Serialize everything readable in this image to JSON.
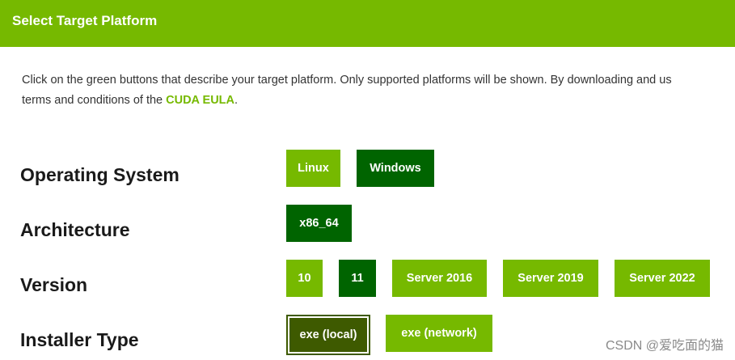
{
  "header": {
    "title": "Select Target Platform",
    "accent_color": "#76b900"
  },
  "intro": {
    "line1": "Click on the green buttons that describe your target platform. Only supported platforms will be shown. By downloading and us",
    "line2_prefix": "terms and conditions of the ",
    "eula_link": "CUDA EULA",
    "line2_suffix": "."
  },
  "rows": {
    "os": {
      "label": "Operating System",
      "options": [
        "Linux",
        "Windows"
      ],
      "selected": "Windows"
    },
    "arch": {
      "label": "Architecture",
      "options": [
        "x86_64"
      ],
      "selected": "x86_64"
    },
    "version": {
      "label": "Version",
      "options": [
        "10",
        "11",
        "Server 2016",
        "Server 2019",
        "Server 2022"
      ],
      "selected": "11"
    },
    "installer": {
      "label": "Installer Type",
      "options": [
        "exe (local)",
        "exe (network)"
      ],
      "selected": "exe (local)"
    }
  },
  "colors": {
    "option": "#76b900",
    "selected": "#006400",
    "selected_focus": "#3e5a00"
  },
  "watermark": "CSDN @爱吃面的猫"
}
